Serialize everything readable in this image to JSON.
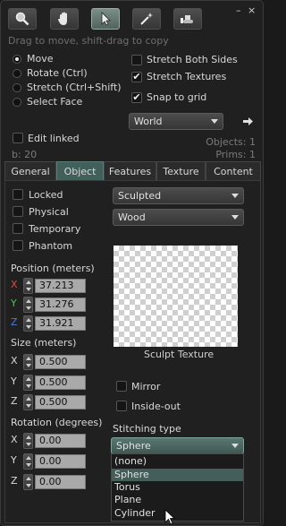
{
  "window": {
    "minimize": "–",
    "close": "×"
  },
  "toolbar": {
    "tools": [
      {
        "icon": "magnifier-icon",
        "active": false
      },
      {
        "icon": "hand-icon",
        "active": false
      },
      {
        "icon": "arrow-cursor-icon",
        "active": true
      },
      {
        "icon": "magic-wand-icon",
        "active": false
      },
      {
        "icon": "bulldozer-icon",
        "active": false
      }
    ],
    "hint": "Drag to move, shift-drag to copy"
  },
  "modes": [
    {
      "label": "Move",
      "selected": true
    },
    {
      "label": "Rotate (Ctrl)",
      "selected": false
    },
    {
      "label": "Stretch (Ctrl+Shift)",
      "selected": false
    },
    {
      "label": "Select Face",
      "selected": false
    }
  ],
  "options": {
    "stretch_both_sides": {
      "label": "Stretch Both Sides",
      "checked": false
    },
    "stretch_textures": {
      "label": "Stretch Textures",
      "checked": true
    },
    "snap_to_grid": {
      "label": "Snap to grid",
      "checked": true
    },
    "ruler": "World",
    "edit_linked": {
      "label": "Edit linked",
      "checked": false
    }
  },
  "status": {
    "objects": "Objects: 1",
    "prims": "Prims: 1",
    "land_impact": "b: 20"
  },
  "tabs": [
    "General",
    "Object",
    "Features",
    "Texture",
    "Content"
  ],
  "active_tab": "Object",
  "object": {
    "flags": [
      {
        "label": "Locked",
        "checked": false
      },
      {
        "label": "Physical",
        "checked": false
      },
      {
        "label": "Temporary",
        "checked": false
      },
      {
        "label": "Phantom",
        "checked": false
      }
    ],
    "prim_type": "Sculpted",
    "material": "Wood",
    "position_label": "Position (meters)",
    "position": {
      "x": "37.213",
      "y": "31.276",
      "z": "31.921"
    },
    "size_label": "Size (meters)",
    "size": {
      "x": "0.500",
      "y": "0.500",
      "z": "0.500"
    },
    "rotation_label": "Rotation (degrees)",
    "rotation": {
      "x": "0.00",
      "y": "0.00",
      "z": "0.00"
    },
    "axis_labels": {
      "x": "X",
      "y": "Y",
      "z": "Z"
    },
    "axis_colors": {
      "x": "#e04a3a",
      "y": "#4ec24e",
      "z": "#4a7be0"
    },
    "sculpt_texture_label": "Sculpt Texture",
    "mirror": {
      "label": "Mirror",
      "checked": false
    },
    "inside_out": {
      "label": "Inside-out",
      "checked": false
    },
    "stitching_label": "Stitching type",
    "stitching_value": "Sphere",
    "stitching_options": [
      "(none)",
      "Sphere",
      "Torus",
      "Plane",
      "Cylinder"
    ],
    "stitching_highlighted": "Sphere"
  }
}
